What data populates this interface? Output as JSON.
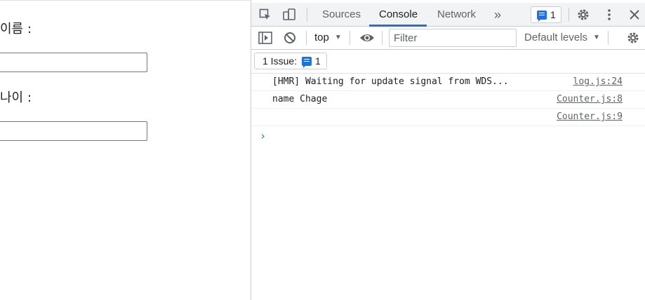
{
  "page": {
    "name_label": "이름 :",
    "name_value": "",
    "age_label": "나이 :",
    "age_value": ""
  },
  "devtools": {
    "tabs": [
      {
        "label": "Sources",
        "active": false
      },
      {
        "label": "Console",
        "active": true
      },
      {
        "label": "Network",
        "active": false
      }
    ],
    "more_tabs_glyph": "»",
    "message_badge_count": "1",
    "context": "top",
    "filter_placeholder": "Filter",
    "levels": "Default levels",
    "issues_label": "1 Issue:",
    "issues_count": "1",
    "console_rows": [
      {
        "message": "[HMR] Waiting for update signal from WDS...",
        "source": "log.js:24"
      },
      {
        "message": "name Chage",
        "source": "Counter.js:8"
      },
      {
        "message": "",
        "source": "Counter.js:9"
      }
    ],
    "prompt_glyph": "›",
    "colors": {
      "accent": "#1a73e8",
      "icon": "#5f6368",
      "border": "#cacdd1"
    }
  }
}
